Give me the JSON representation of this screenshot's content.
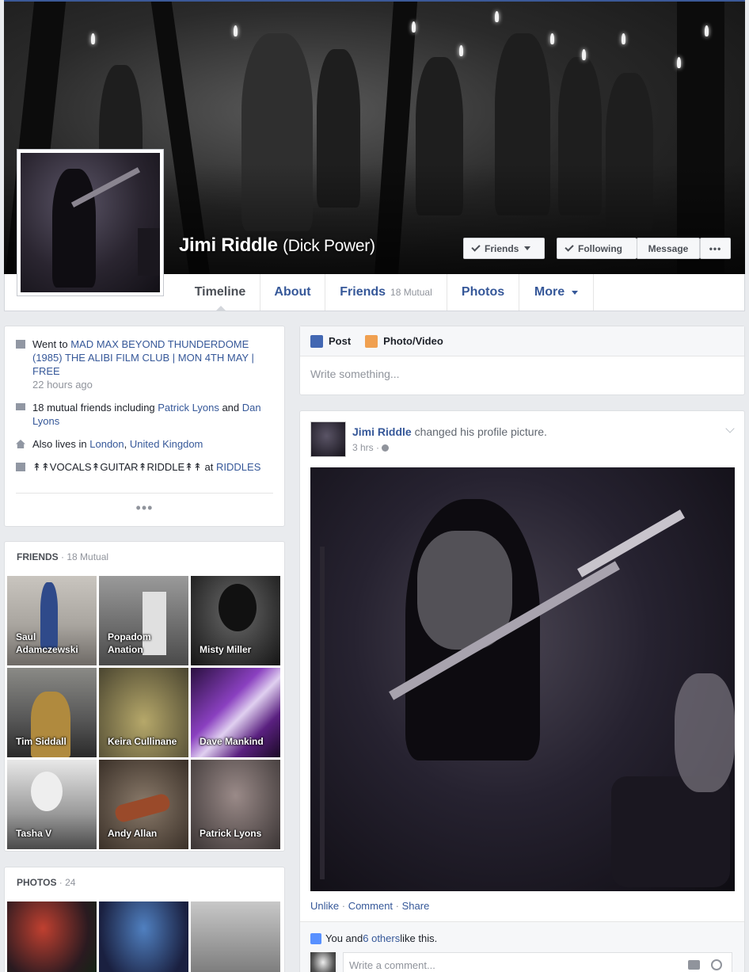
{
  "profile": {
    "name": "Jimi Riddle",
    "alt_name": "(Dick Power)"
  },
  "cover_buttons": {
    "friends": "Friends",
    "following": "Following",
    "message": "Message",
    "more": "•••"
  },
  "nav": {
    "tabs": [
      {
        "label": "Timeline"
      },
      {
        "label": "About"
      },
      {
        "label": "Friends",
        "count": "18 Mutual"
      },
      {
        "label": "Photos"
      },
      {
        "label": "More"
      }
    ]
  },
  "intro": {
    "event_prefix": "Went to ",
    "event_link": "MAD MAX BEYOND THUNDERDOME (1985) THE ALIBI FILM CLUB | MON 4TH MAY | FREE",
    "event_time": "22 hours ago",
    "mutual_prefix": "18 mutual friends including ",
    "mutual_friend_1": "Patrick Lyons",
    "mutual_and": " and ",
    "mutual_friend_2": "Dan Lyons",
    "lives_prefix": "Also lives in ",
    "lives_city": "London",
    "lives_sep": ", ",
    "lives_country": "United Kingdom",
    "work_title": "↟↟VOCALS↟GUITAR↟RIDDLE↟↟",
    "work_at": " at ",
    "work_place": "RIDDLES",
    "more": "•••"
  },
  "friends_card": {
    "title": "FRIENDS",
    "count": " · 18 Mutual",
    "items": [
      {
        "name": "Saul Adamczewski"
      },
      {
        "name": "Popadom Anation"
      },
      {
        "name": "Misty Miller"
      },
      {
        "name": "Tim Siddall"
      },
      {
        "name": "Keira Cullinane"
      },
      {
        "name": "Dave Mankind"
      },
      {
        "name": "Tasha V"
      },
      {
        "name": "Andy Allan"
      },
      {
        "name": "Patrick Lyons"
      }
    ]
  },
  "photos_card": {
    "title": "PHOTOS",
    "count": " · 24"
  },
  "composer": {
    "post": "Post",
    "photo_video": "Photo/Video",
    "placeholder": "Write something..."
  },
  "post": {
    "author": "Jimi Riddle",
    "action": " changed his profile picture.",
    "time": "3 hrs · ",
    "unlike": "Unlike",
    "comment": "Comment",
    "share": "Share",
    "sep": " · ",
    "likes_prefix": "You and ",
    "likes_link": "6 others",
    "likes_suffix": " like this.",
    "comment_placeholder": "Write a comment..."
  },
  "colors": {
    "link": "#365899",
    "brand": "#3b5998",
    "background": "#e9ebee"
  }
}
